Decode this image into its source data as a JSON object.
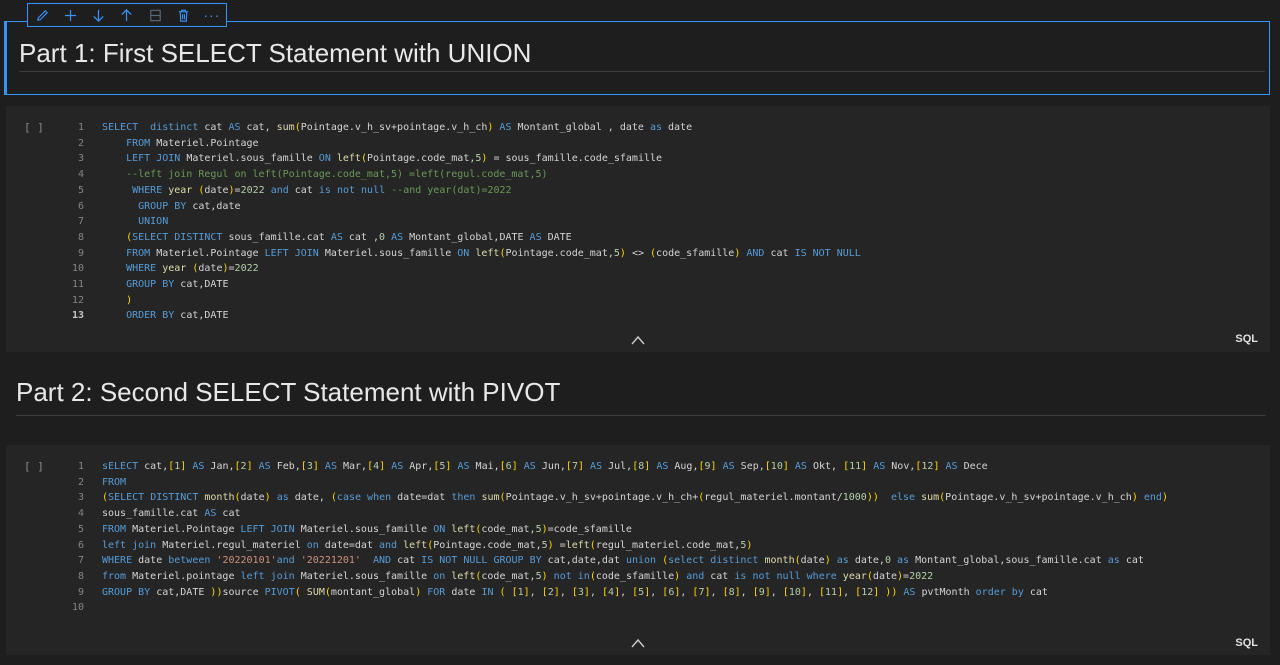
{
  "toolbar": {
    "icons": [
      "edit-icon",
      "add-icon",
      "move-down-icon",
      "move-up-icon",
      "split-icon",
      "delete-icon",
      "more-icon"
    ],
    "more_label": "···"
  },
  "markdown1": {
    "title": "Part 1: First SELECT Statement with UNION"
  },
  "markdown2": {
    "title": "Part 2: Second SELECT Statement with PIVOT"
  },
  "cell1": {
    "run_label": "[ ]",
    "language": "SQL",
    "active_line": 13,
    "lines": [
      "SELECT  distinct cat AS cat, sum(Pointage.v_h_sv+pointage.v_h_ch) AS Montant_global , date as date",
      "    FROM Materiel.Pointage",
      "    LEFT JOIN Materiel.sous_famille ON left(Pointage.code_mat,5) = sous_famille.code_sfamille",
      "    --left join Regul on left(Pointage.code_mat,5) =left(regul.code_mat,5)",
      "     WHERE year (date)=2022 and cat is not null --and year(dat)=2022",
      "      GROUP BY cat,date",
      "      UNION",
      "    (SELECT DISTINCT sous_famille.cat AS cat ,0 AS Montant_global,DATE AS DATE",
      "    FROM Materiel.Pointage LEFT JOIN Materiel.sous_famille ON left(Pointage.code_mat,5) <> (code_sfamille) AND cat IS NOT NULL",
      "    WHERE year (date)=2022",
      "    GROUP BY cat,DATE",
      "    )",
      "    ORDER BY cat,DATE"
    ]
  },
  "cell2": {
    "run_label": "[ ]",
    "language": "SQL",
    "active_line": 0,
    "lines": [
      "sELECT cat,[1] AS Jan,[2] AS Feb,[3] AS Mar,[4] AS Apr,[5] AS Mai,[6] AS Jun,[7] AS Jul,[8] AS Aug,[9] AS Sep,[10] AS Okt, [11] AS Nov,[12] AS Dece",
      "FROM",
      "(SELECT DISTINCT month(date) as date, (case when date=dat then sum(Pointage.v_h_sv+pointage.v_h_ch+(regul_materiel.montant/1000))  else sum(Pointage.v_h_sv+pointage.v_h_ch) end)",
      "sous_famille.cat AS cat",
      "FROM Materiel.Pointage LEFT JOIN Materiel.sous_famille ON left(code_mat,5)=code_sfamille",
      "left join Materiel.regul_materiel on date=dat and left(Pointage.code_mat,5) =left(regul_materiel.code_mat,5)",
      "WHERE date between '20220101'and '20221201'  AND cat IS NOT NULL GROUP BY cat,date,dat union (select distinct month(date) as date,0 as Montant_global,sous_famille.cat as cat",
      "from Materiel.pointage left join Materiel.sous_famille on left(code_mat,5) not in(code_sfamille) and cat is not null where year(date)=2022",
      "GROUP BY cat,DATE ))source PIVOT( SUM(montant_global) FOR date IN ( [1], [2], [3], [4], [5], [6], [7], [8], [9], [10], [11], [12] )) AS pvtMonth order by cat",
      ""
    ]
  },
  "colors": {
    "accent": "#3794ff",
    "background": "#1e1e1e",
    "cell_background": "#252526"
  }
}
